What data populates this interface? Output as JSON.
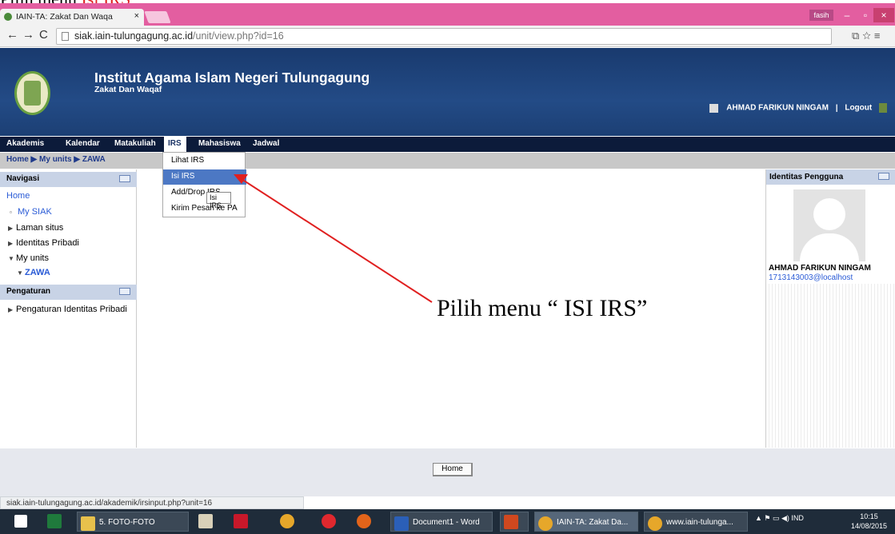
{
  "slide_title": {
    "prefix": "Pilih menu",
    "highlight": "Isi IRS"
  },
  "browser": {
    "tab_title": "IAIN-TA: Zakat Dan Waqa",
    "tab_close": "×",
    "user_chip": "fasih",
    "win_min": "–",
    "win_max": "▫",
    "win_close": "×",
    "back": "←",
    "forward": "→",
    "reload": "C",
    "url_host": "siak.iain-tulungagung.ac.id",
    "url_path": "/unit/view.php?id=16",
    "toolbar_icons": "⧉☆≡"
  },
  "header": {
    "title": "Institut Agama Islam Negeri Tulungagung",
    "subtitle": "Zakat Dan Waqaf",
    "user_name": "AHMAD FARIKUN NINGAM",
    "separator": "|",
    "logout": "Logout"
  },
  "menu": {
    "akademis": "Akademis",
    "kalendar": "Kalendar",
    "matakuliah": "Matakuliah",
    "irs": "IRS",
    "mahasiswa": "Mahasiswa",
    "jadwal": "Jadwal"
  },
  "breadcrumb": "Home ▶ My units ▶ ZAWA",
  "dropdown": {
    "lihat": "Lihat IRS",
    "isi": "Isi IRS",
    "adddrop": "Add/Drop IRS",
    "kirim": "Kirim Pesan ke PA",
    "tooltip": "Isi IRS"
  },
  "navigasi": {
    "title": "Navigasi",
    "home": "Home",
    "my_siak": "My SIAK",
    "laman_situs": "Laman situs",
    "identitas_pribadi": "Identitas Pribadi",
    "my_units": "My units",
    "zawa": "ZAWA"
  },
  "pengaturan": {
    "title": "Pengaturan",
    "item": "Pengaturan Identitas Pribadi"
  },
  "identitas": {
    "title": "Identitas Pengguna",
    "name": "AHMAD FARIKUN NINGAM",
    "email": "1713143003@localhost"
  },
  "annotation": "Pilih menu “ ISI IRS”",
  "footer": {
    "home_button": "Home"
  },
  "status_url": "siak.iain-tulungagung.ac.id/akademik/irsinput.php?unit=16",
  "taskbar": {
    "folder": "5. FOTO-FOTO",
    "word": "Document1 - Word",
    "chrome1": "IAIN-TA: Zakat Da...",
    "chrome2": "www.iain-tulunga...",
    "tray": "▲  ⚑  ▭  ◀)   IND",
    "time": "10:15",
    "date": "14/08/2015"
  },
  "colors": {
    "header_bg": "#234b86",
    "menu_bg": "#0c1b3a",
    "tab_strip": "#e35ea0",
    "highlight": "#4c78c4",
    "arrow": "#e02020"
  }
}
